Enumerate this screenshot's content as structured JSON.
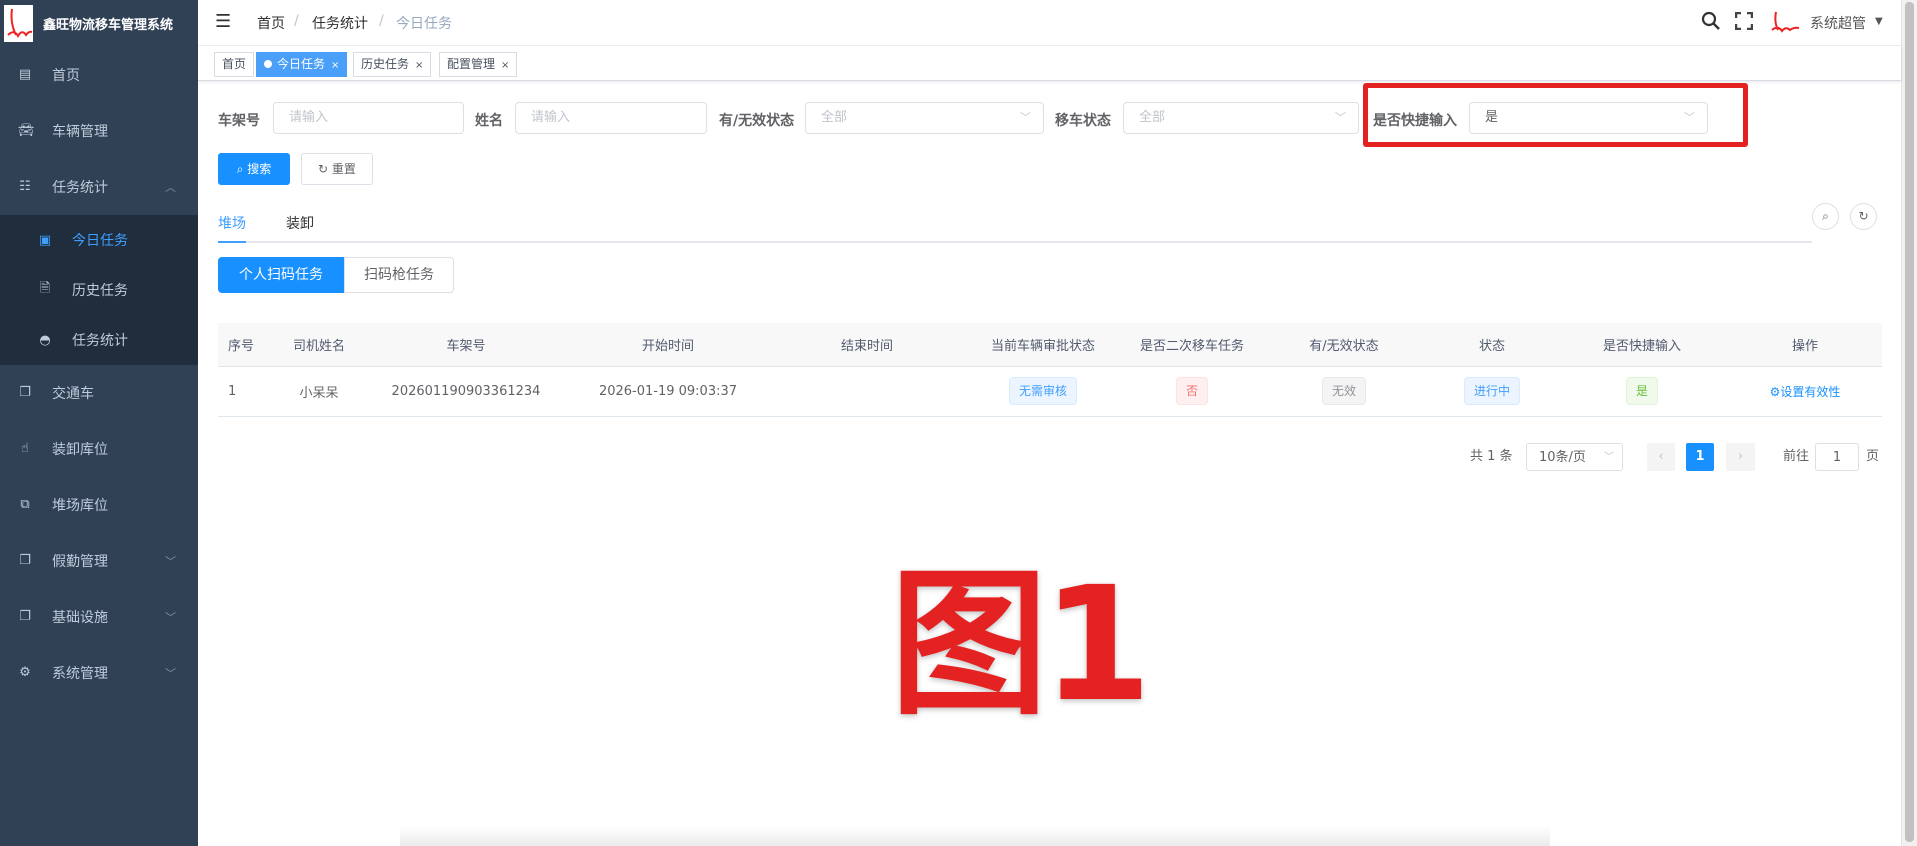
{
  "app": {
    "title": "鑫旺物流移车管理系统"
  },
  "sidebar": {
    "items": [
      {
        "label": "首页",
        "icon": "dashboard-icon"
      },
      {
        "label": "车辆管理",
        "icon": "car-icon"
      },
      {
        "label": "任务统计",
        "icon": "tree-icon",
        "expanded": true,
        "children": [
          {
            "label": "今日任务",
            "icon": "clipboard-icon",
            "active": true
          },
          {
            "label": "历史任务",
            "icon": "history-doc-icon"
          },
          {
            "label": "任务统计",
            "icon": "gauge-icon"
          }
        ]
      },
      {
        "label": "交通车",
        "icon": "copy-icon"
      },
      {
        "label": "装卸库位",
        "icon": "hand-icon"
      },
      {
        "label": "堆场库位",
        "icon": "puzzle-icon"
      },
      {
        "label": "假勤管理",
        "icon": "copy-icon",
        "has_children": true
      },
      {
        "label": "基础设施",
        "icon": "copy-icon",
        "has_children": true
      },
      {
        "label": "系统管理",
        "icon": "gear-icon",
        "has_children": true
      }
    ]
  },
  "header": {
    "breadcrumb": [
      "首页",
      "任务统计",
      "今日任务"
    ],
    "user": "系统超管"
  },
  "tags": [
    {
      "label": "首页"
    },
    {
      "label": "今日任务",
      "active": true
    },
    {
      "label": "历史任务"
    },
    {
      "label": "配置管理"
    }
  ],
  "filters": {
    "frame_no": {
      "label": "车架号",
      "placeholder": "请输入"
    },
    "name": {
      "label": "姓名",
      "placeholder": "请输入"
    },
    "valid": {
      "label": "有/无效状态",
      "value": "全部"
    },
    "move": {
      "label": "移车状态",
      "value": "全部"
    },
    "quick": {
      "label": "是否快捷输入",
      "value": "是"
    },
    "search": "搜索",
    "reset": "重置"
  },
  "tabs": [
    "堆场",
    "装卸"
  ],
  "subtabs": [
    "个人扫码任务",
    "扫码枪任务"
  ],
  "table": {
    "headers": [
      "序号",
      "司机姓名",
      "车架号",
      "开始时间",
      "结束时间",
      "当前车辆审批状态",
      "是否二次移车任务",
      "有/无效状态",
      "状态",
      "是否快捷输入",
      "操作"
    ],
    "rows": [
      {
        "no": "1",
        "driver": "小呆呆",
        "frame": "202601190903361234",
        "start": "2026-01-19 09:03:37",
        "end": "",
        "approval": "无需审核",
        "second": "否",
        "valid": "无效",
        "status": "进行中",
        "quick": "是",
        "action": "设置有效性"
      }
    ]
  },
  "pagination": {
    "total": "共 1 条",
    "page_size": "10条/页",
    "current": "1",
    "goto_label": "前往",
    "goto_value": "1",
    "page_suffix": "页"
  },
  "annotation": {
    "text": "图1",
    "color": "#e52222"
  }
}
